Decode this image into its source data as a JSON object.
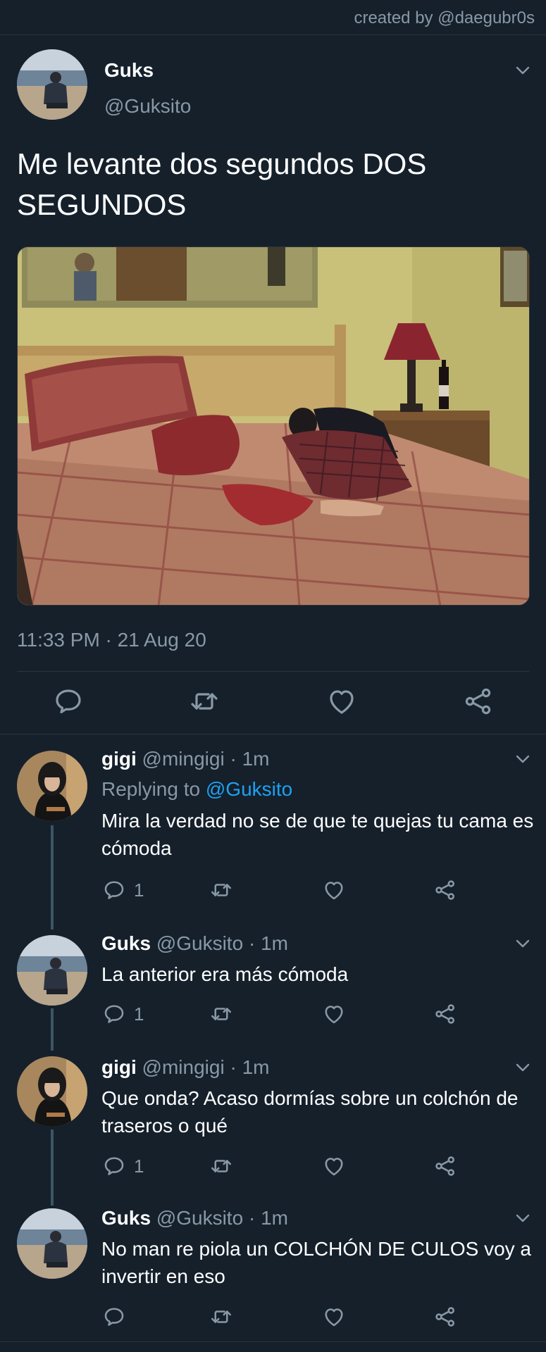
{
  "credit": "created by @daegubr0s",
  "main_tweet": {
    "name": "Guks",
    "handle": "@Guksito",
    "text": "Me levante dos segundos DOS SEGUNDOS",
    "timestamp": "11:33 PM · 21 Aug 20"
  },
  "replies": [
    {
      "name": "gigi",
      "handle": "@mingigi",
      "dot": "·",
      "time": "1m",
      "replying_prefix": "Replying to",
      "replying_to": "@Guksito",
      "text": "Mira la verdad no se de que te quejas tu cama es cómoda",
      "reply_count": "1"
    },
    {
      "name": "Guks",
      "handle": "@Guksito",
      "dot": "·",
      "time": "1m",
      "text": "La anterior era más cómoda",
      "reply_count": "1"
    },
    {
      "name": "gigi",
      "handle": "@mingigi",
      "dot": "·",
      "time": "1m",
      "text": "Que onda? Acaso dormías sobre un colchón de traseros o qué",
      "reply_count": "1"
    },
    {
      "name": "Guks",
      "handle": "@Guksito",
      "dot": "·",
      "time": "1m",
      "text": "No man re piola un COLCHÓN DE CULOS voy a invertir en eso",
      "reply_count": ""
    }
  ],
  "icons": {
    "reply": "reply-icon",
    "retweet": "retweet-icon",
    "like": "heart-icon",
    "share": "share-icon",
    "menu": "chevron-down-icon"
  },
  "colors": {
    "background": "#15202b",
    "secondary_text": "#8899a6",
    "link": "#1da1f2",
    "divider": "#2f3336"
  }
}
